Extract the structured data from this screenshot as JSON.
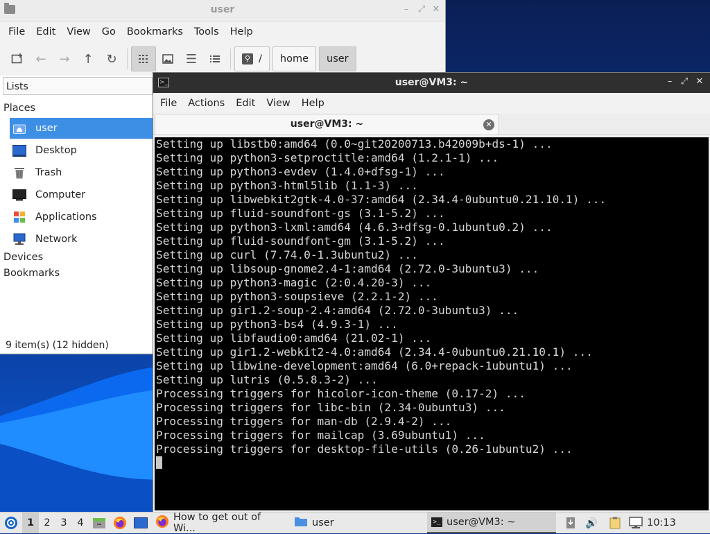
{
  "file_manager": {
    "title": "user",
    "menu": [
      "File",
      "Edit",
      "View",
      "Go",
      "Bookmarks",
      "Tools",
      "Help"
    ],
    "path": [
      "/",
      "home",
      "user"
    ],
    "side_pane_mode": "Lists",
    "sections": {
      "places": "Places",
      "devices": "Devices",
      "bookmarks": "Bookmarks"
    },
    "places": [
      {
        "label": "user",
        "icon": "home-folder-icon",
        "selected": true
      },
      {
        "label": "Desktop",
        "icon": "desktop-icon"
      },
      {
        "label": "Trash",
        "icon": "trash-icon"
      },
      {
        "label": "Computer",
        "icon": "computer-icon"
      },
      {
        "label": "Applications",
        "icon": "applications-icon"
      },
      {
        "label": "Network",
        "icon": "network-icon"
      }
    ],
    "status": "9 item(s) (12 hidden)"
  },
  "terminal": {
    "title": "user@VM3: ~",
    "menu": [
      "File",
      "Actions",
      "Edit",
      "View",
      "Help"
    ],
    "tab_label": "user@VM3: ~",
    "lines": [
      "Setting up libstb0:amd64 (0.0~git20200713.b42009b+ds-1) ...",
      "Setting up python3-setproctitle:amd64 (1.2.1-1) ...",
      "Setting up python3-evdev (1.4.0+dfsg-1) ...",
      "Setting up python3-html5lib (1.1-3) ...",
      "Setting up libwebkit2gtk-4.0-37:amd64 (2.34.4-0ubuntu0.21.10.1) ...",
      "Setting up fluid-soundfont-gs (3.1-5.2) ...",
      "Setting up python3-lxml:amd64 (4.6.3+dfsg-0.1ubuntu0.2) ...",
      "Setting up fluid-soundfont-gm (3.1-5.2) ...",
      "Setting up curl (7.74.0-1.3ubuntu2) ...",
      "Setting up libsoup-gnome2.4-1:amd64 (2.72.0-3ubuntu3) ...",
      "Setting up python3-magic (2:0.4.20-3) ...",
      "Setting up python3-soupsieve (2.2.1-2) ...",
      "Setting up gir1.2-soup-2.4:amd64 (2.72.0-3ubuntu3) ...",
      "Setting up python3-bs4 (4.9.3-1) ...",
      "Setting up libfaudio0:amd64 (21.02-1) ...",
      "Setting up gir1.2-webkit2-4.0:amd64 (2.34.4-0ubuntu0.21.10.1) ...",
      "Setting up libwine-development:amd64 (6.0+repack-1ubuntu1) ...",
      "Setting up lutris (0.5.8.3-2) ...",
      "Processing triggers for hicolor-icon-theme (0.17-2) ...",
      "Processing triggers for libc-bin (2.34-0ubuntu3) ...",
      "Processing triggers for man-db (2.9.4-2) ...",
      "Processing triggers for mailcap (3.69ubuntu1) ...",
      "Processing triggers for desktop-file-utils (0.26-1ubuntu2) ..."
    ]
  },
  "taskbar": {
    "workspaces": [
      "1",
      "2",
      "3",
      "4"
    ],
    "active_workspace": "1",
    "tasks": [
      {
        "label": "How to get out of Wi...",
        "icon": "firefox-icon"
      },
      {
        "label": "user",
        "icon": "folder-icon"
      },
      {
        "label": "user@VM3: ~",
        "icon": "terminal-icon",
        "active": true
      }
    ],
    "clock": "10:13"
  },
  "colors": {
    "accent": "#3d8ee5",
    "terminal_bg": "#000000",
    "terminal_fg": "#d6d6d6"
  }
}
